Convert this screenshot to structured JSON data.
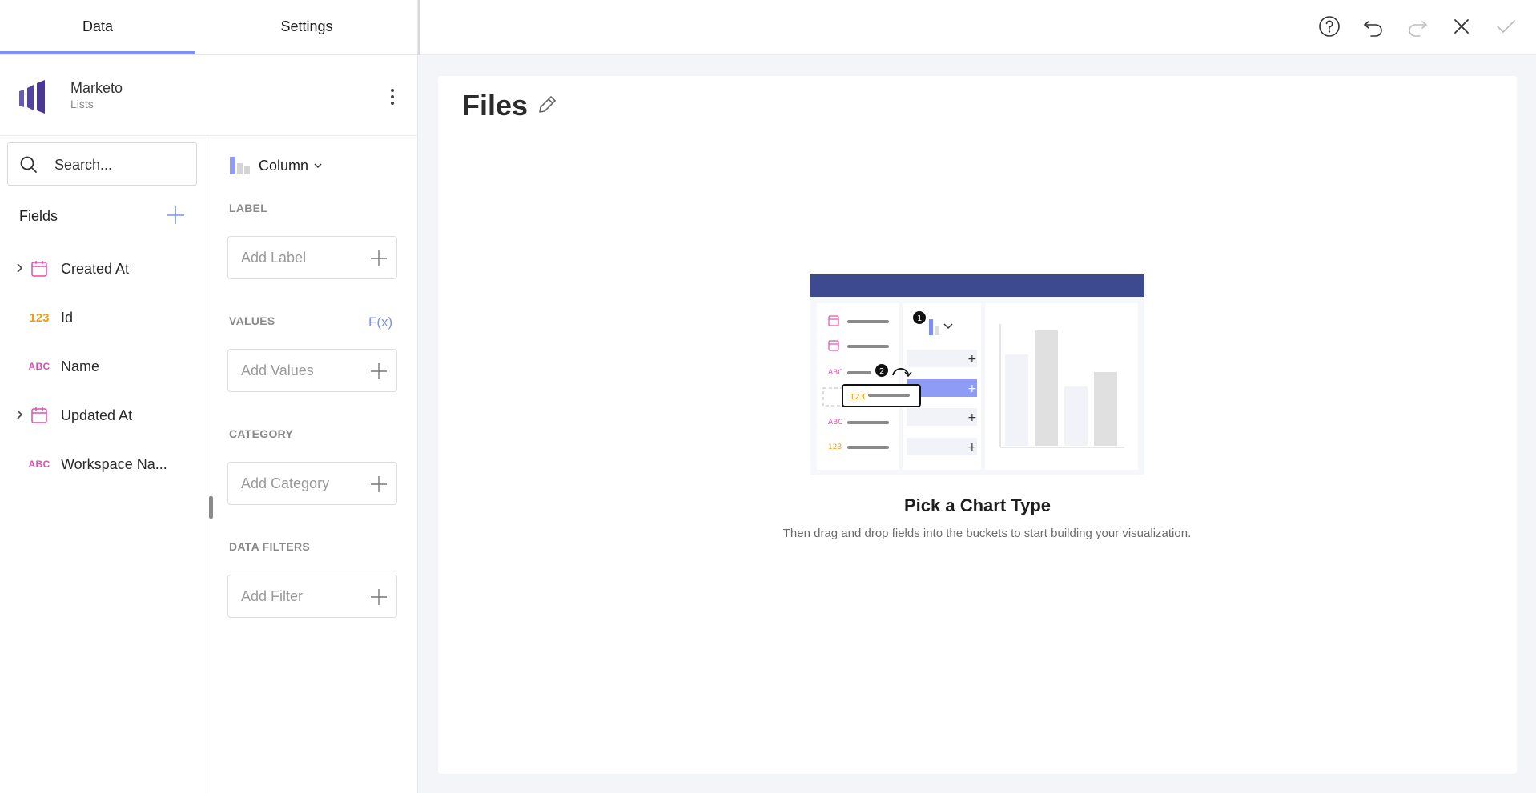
{
  "tabs": {
    "data_label": "Data",
    "settings_label": "Settings"
  },
  "source": {
    "name": "Marketo",
    "subtitle": "Lists"
  },
  "search": {
    "placeholder": "Search..."
  },
  "fields": {
    "title": "Fields",
    "items": [
      {
        "label": "Created At",
        "type": "date",
        "expandable": true
      },
      {
        "label": "Id",
        "type": "123",
        "expandable": false
      },
      {
        "label": "Name",
        "type": "ABC",
        "expandable": false
      },
      {
        "label": "Updated At",
        "type": "date",
        "expandable": true
      },
      {
        "label": "Workspace Na...",
        "type": "ABC",
        "expandable": false
      }
    ]
  },
  "chart_type": {
    "label": "Column"
  },
  "buckets": {
    "label": {
      "title": "LABEL",
      "placeholder": "Add Label"
    },
    "values": {
      "title": "VALUES",
      "placeholder": "Add Values",
      "fx": "F(x)"
    },
    "category": {
      "title": "CATEGORY",
      "placeholder": "Add Category"
    },
    "filters": {
      "title": "DATA FILTERS",
      "placeholder": "Add Filter"
    }
  },
  "canvas": {
    "title": "Files",
    "empty_title": "Pick a Chart Type",
    "empty_description": "Then drag and drop fields into the buckets to start building your visualization."
  },
  "illustration": {
    "step1": "1",
    "step2": "2",
    "num_badge": "123",
    "abc_badge": "ABC"
  },
  "colors": {
    "accent": "#7f8ff4",
    "brand": "#5c4ba6",
    "date_icon": "#e04fb0",
    "number_icon": "#f39c12",
    "illustration_header": "#3d4a8f"
  }
}
